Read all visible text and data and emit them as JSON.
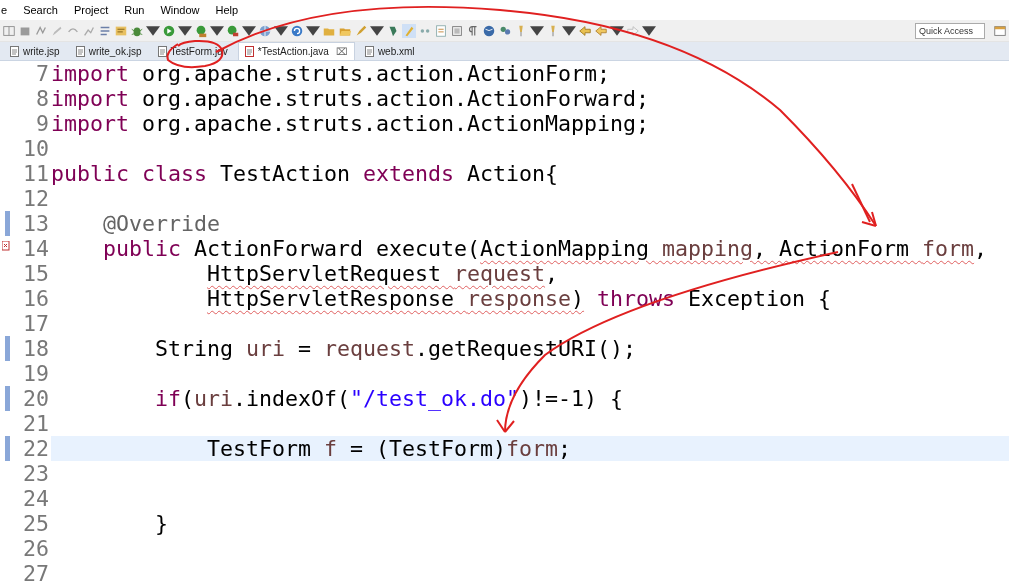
{
  "menu": [
    "e",
    "Search",
    "Project",
    "Run",
    "Window",
    "Help"
  ],
  "quick_access": {
    "placeholder": "Quick Access"
  },
  "tabs": [
    {
      "label": "write.jsp",
      "selected": false,
      "closable": false
    },
    {
      "label": "write_ok.jsp",
      "selected": false,
      "closable": false
    },
    {
      "label": "TestForm.jav",
      "selected": false,
      "closable": false
    },
    {
      "label": "*TestAction.java",
      "selected": true,
      "closable": true,
      "close": "⌧"
    },
    {
      "label": "web.xml",
      "selected": false,
      "closable": false
    }
  ],
  "lines": [
    {
      "number": "7",
      "kind": "top",
      "changed": false,
      "error": false,
      "current": false,
      "tokens": [
        {
          "kind": "keyword",
          "text": "import"
        },
        {
          "kind": "plain",
          "text": " org.apache.struts.action.ActionForm;"
        }
      ]
    },
    {
      "number": "8",
      "kind": "top",
      "changed": false,
      "error": false,
      "current": false,
      "tokens": [
        {
          "kind": "keyword",
          "text": "import"
        },
        {
          "kind": "plain",
          "text": " org.apache.struts.action.ActionForward;"
        }
      ]
    },
    {
      "number": "9",
      "kind": "top",
      "changed": false,
      "error": false,
      "current": false,
      "tokens": [
        {
          "kind": "keyword",
          "text": "import"
        },
        {
          "kind": "plain",
          "text": " org.apache.struts.action.ActionMapping;"
        }
      ]
    },
    {
      "number": "10",
      "kind": "top",
      "changed": false,
      "error": false,
      "current": false
    },
    {
      "number": "11",
      "kind": "top",
      "changed": false,
      "error": false,
      "current": false,
      "tokens": [
        {
          "kind": "keyword",
          "text": "public"
        },
        {
          "kind": "keyword",
          "text": " class"
        },
        {
          "kind": "plain",
          "text": " TestAction "
        },
        {
          "kind": "keyword",
          "text": "extends"
        },
        {
          "kind": "plain",
          "text": " Action{"
        }
      ]
    },
    {
      "number": "12",
      "kind": "top",
      "changed": false,
      "error": false,
      "current": false
    },
    {
      "number": "13",
      "kind": "member",
      "changed": true,
      "error": false,
      "current": false,
      "tokens": [
        {
          "kind": "annotation",
          "text": "@Override"
        }
      ]
    },
    {
      "number": "14",
      "kind": "member",
      "changed": false,
      "error": true,
      "current": false,
      "tokens": [
        {
          "kind": "keyword",
          "text": "public"
        },
        {
          "kind": "plain",
          "text": " ActionForward execute("
        },
        {
          "kind": "plain",
          "text": "ActionMapping ",
          "squiggle": true
        },
        {
          "kind": "variable",
          "text": "mapping",
          "squiggle": true
        },
        {
          "kind": "plain",
          "text": ", ActionForm ",
          "squiggle": true
        },
        {
          "kind": "variable",
          "text": "form",
          "squiggle": true
        },
        {
          "kind": "plain",
          "text": ","
        }
      ]
    },
    {
      "number": "15",
      "kind": "continuation",
      "changed": false,
      "error": false,
      "current": false,
      "tokens": [
        {
          "kind": "plain",
          "text": "HttpServletRequest ",
          "squiggle": true
        },
        {
          "kind": "variable",
          "text": "request",
          "squiggle": true
        },
        {
          "kind": "plain",
          "text": ","
        }
      ]
    },
    {
      "number": "16",
      "kind": "continuation",
      "changed": false,
      "error": false,
      "current": false,
      "tokens": [
        {
          "kind": "plain",
          "text": "HttpServletResponse ",
          "squiggle": true
        },
        {
          "kind": "variable",
          "text": "response",
          "squiggle": true
        },
        {
          "kind": "plain",
          "text": ")",
          "squiggle": true
        },
        {
          "kind": "keyword",
          "text": " throws"
        },
        {
          "kind": "plain",
          "text": " Exception {"
        }
      ]
    },
    {
      "number": "17",
      "kind": "top",
      "changed": false,
      "error": false,
      "current": false
    },
    {
      "number": "18",
      "kind": "body",
      "changed": true,
      "error": false,
      "current": false,
      "tokens": [
        {
          "kind": "plain",
          "text": "String "
        },
        {
          "kind": "variable",
          "text": "uri"
        },
        {
          "kind": "plain",
          "text": " = "
        },
        {
          "kind": "variable",
          "text": "request"
        },
        {
          "kind": "plain",
          "text": ".getRequestURI();"
        }
      ]
    },
    {
      "number": "19",
      "kind": "top",
      "changed": false,
      "error": false,
      "current": false
    },
    {
      "number": "20",
      "kind": "body",
      "changed": true,
      "error": false,
      "current": false,
      "tokens": [
        {
          "kind": "keyword",
          "text": "if"
        },
        {
          "kind": "plain",
          "text": "("
        },
        {
          "kind": "variable",
          "text": "uri"
        },
        {
          "kind": "plain",
          "text": ".indexOf("
        },
        {
          "kind": "string",
          "text": "\"/test_ok.do\""
        },
        {
          "kind": "plain",
          "text": ")!=-1) {"
        }
      ]
    },
    {
      "number": "21",
      "kind": "top",
      "changed": false,
      "error": false,
      "current": false
    },
    {
      "number": "22",
      "kind": "nested",
      "changed": true,
      "error": false,
      "current": true,
      "tokens": [
        {
          "kind": "plain",
          "text": "TestForm "
        },
        {
          "kind": "variable",
          "text": "f"
        },
        {
          "kind": "plain",
          "text": " = (TestForm)"
        },
        {
          "kind": "variable",
          "text": "form"
        },
        {
          "kind": "plain",
          "text": ";"
        }
      ]
    },
    {
      "number": "23",
      "kind": "top",
      "changed": false,
      "error": false,
      "current": false
    },
    {
      "number": "24",
      "kind": "top",
      "changed": false,
      "error": false,
      "current": false
    },
    {
      "number": "25",
      "kind": "body",
      "changed": false,
      "error": false,
      "current": false,
      "tokens": [
        {
          "kind": "plain",
          "text": "}"
        }
      ]
    },
    {
      "number": "26",
      "kind": "top",
      "changed": false,
      "error": false,
      "current": false
    },
    {
      "number": "27",
      "kind": "top",
      "changed": false,
      "error": false,
      "current": false
    }
  ]
}
